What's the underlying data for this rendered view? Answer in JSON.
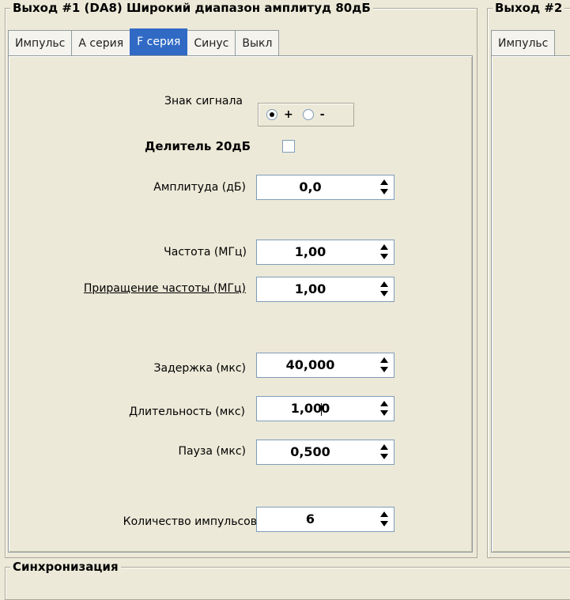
{
  "output1": {
    "title": "Выход #1 (DA8) Широкий диапазон амплитуд 80дБ",
    "tabs": [
      "Импульс",
      "А серия",
      "F серия",
      "Синус",
      "Выкл"
    ],
    "active_tab": "F серия",
    "sign": {
      "label": "Знак сигнала",
      "plus": "+",
      "minus": "-",
      "selected": "+"
    },
    "divider": {
      "label": "Делитель 20дБ",
      "checked": false
    },
    "amplitude": {
      "label": "Амплитуда (дБ)",
      "value": "0,0"
    },
    "frequency": {
      "label": "Частота (МГц)",
      "value": "1,00"
    },
    "freq_step": {
      "label": "Приращение частоты (МГц)",
      "value": "1,00"
    },
    "delay": {
      "label": "Задержка (мкс)",
      "value": "40,000"
    },
    "duration": {
      "label": "Длительность (мкс)",
      "value_before_caret": "1,00",
      "value_after_caret": "0"
    },
    "pause": {
      "label": "Пауза (мкс)",
      "value": "0,500"
    },
    "pulse_count": {
      "label": "Количество импульсов",
      "value": "6"
    }
  },
  "output2": {
    "title": "Выход #2",
    "tabs": [
      "Импульс"
    ]
  },
  "sync": {
    "title": "Синхронизация"
  }
}
